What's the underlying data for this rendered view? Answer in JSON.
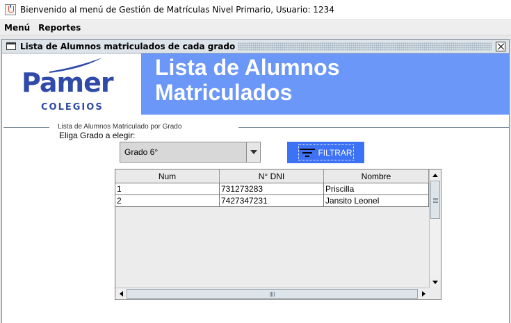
{
  "window": {
    "title": "Bienvenido al menú de Gestión de Matrículas Nivel Primario, Usuario: 1234"
  },
  "menubar": {
    "items": [
      {
        "label": "Menú"
      },
      {
        "label": "Reportes"
      }
    ]
  },
  "internal_frame": {
    "title": "Lista de Alumnos matriculados de cada grado"
  },
  "logo": {
    "name": "Pamer",
    "subtitle": "COLEGIOS",
    "color": "#2f4aa8"
  },
  "banner": {
    "title": "Lista de Alumnos Matriculados",
    "color": "#6b97f9"
  },
  "group": {
    "title": "Lista de Alumnos Matriculado por Grado",
    "prompt": "Eliga Grado a elegir:"
  },
  "grade_select": {
    "value": "Grado 6°"
  },
  "filter_button": {
    "label": "FILTRAR",
    "icon": "filter-icon",
    "color": "#3e72f4"
  },
  "table": {
    "columns": [
      "Num",
      "N° DNI",
      "Nombre"
    ],
    "rows": [
      [
        "1",
        "731273283",
        "Priscilla"
      ],
      [
        "2",
        "7427347231",
        "Jansito Leonel"
      ]
    ]
  }
}
